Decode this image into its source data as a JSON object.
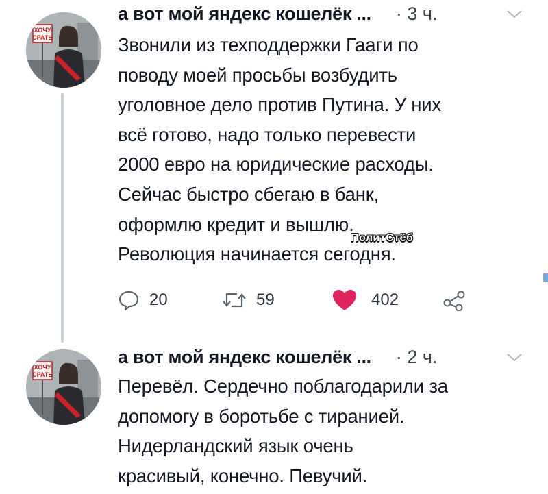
{
  "tweets": [
    {
      "author": "а вот мой яндекс кошелёк ...",
      "time": "· 3 ч.",
      "lines": [
        "Звонили из техподдержки Гааги по",
        "поводу моей просьбы возбудить",
        "уголовное дело против Путина. У них",
        "всё готово, надо только перевести",
        "2000 евро на юридические расходы.",
        "Сейчас быстро сбегаю в банк,",
        "оформлю кредит и вышлю.",
        "Революция начинается сегодня."
      ],
      "replies": "20",
      "retweets": "59",
      "likes": "402",
      "liked": true,
      "avatar_sign": "ХОЧУ СРАТЬ"
    },
    {
      "author": "а вот мой яндекс кошелёк ...",
      "time": "· 2 ч.",
      "lines": [
        "Перевёл. Сердечно поблагодарили за",
        "допомогу в боротьбе с тиранией.",
        "Нидерландский язык очень",
        "красивый, конечно. Певучий."
      ],
      "avatar_sign": "ХОЧУ СРАТЬ"
    }
  ],
  "watermark": "ПолитСтёб",
  "icons": {
    "reply": "reply-icon",
    "retweet": "retweet-icon",
    "like": "heart-icon",
    "share": "share-icon",
    "menu": "chevron-down-icon"
  },
  "colors": {
    "like": "#e0245e",
    "icon": "#5b6670",
    "thread": "#c9d2d9"
  }
}
